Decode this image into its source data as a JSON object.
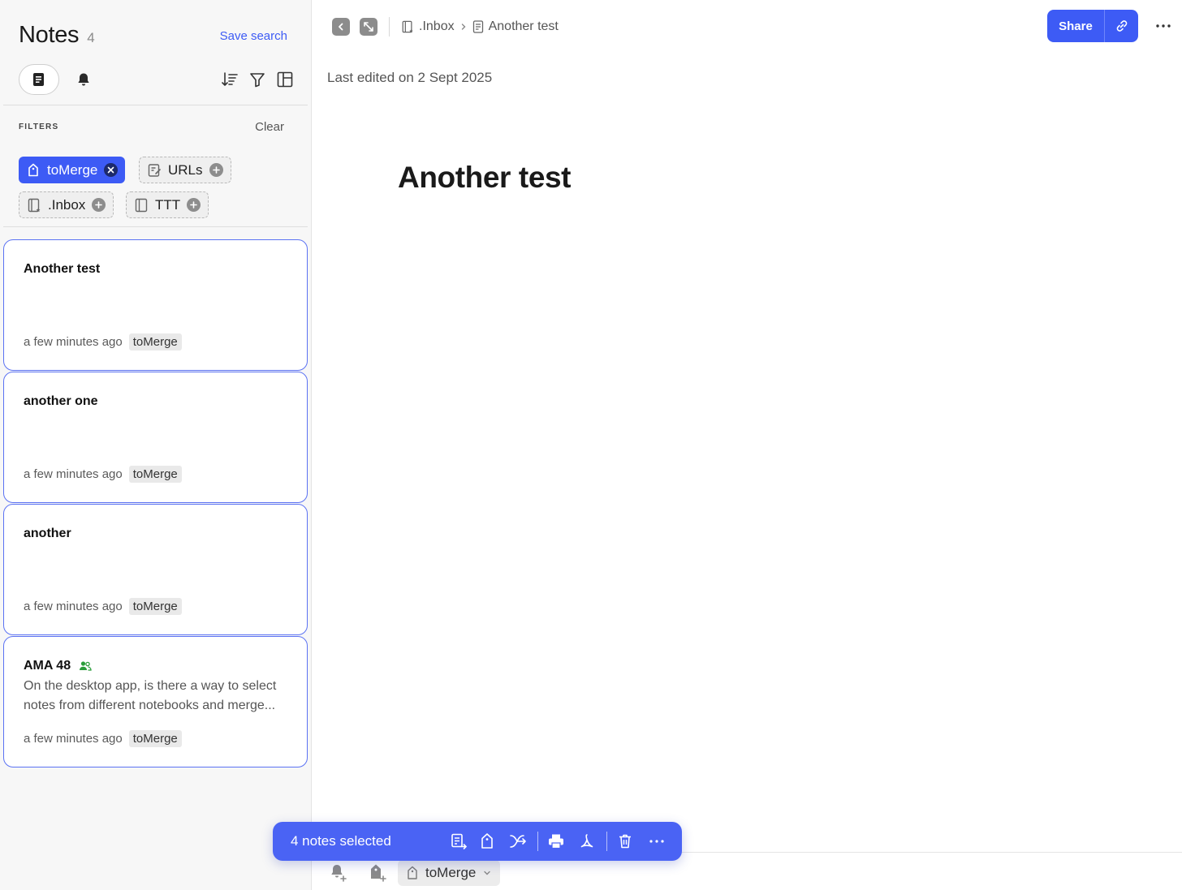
{
  "sidebar": {
    "title": "Notes",
    "count": "4",
    "save_search": "Save search",
    "filters_label": "FILTERS",
    "clear": "Clear",
    "chips": [
      {
        "label": "toMerge",
        "icon": "tag-icon",
        "active": true
      },
      {
        "label": "URLs",
        "icon": "url-note-icon",
        "active": false
      },
      {
        "label": ".Inbox",
        "icon": "inbox-notebook-icon",
        "active": false
      },
      {
        "label": "TTT",
        "icon": "notebook-icon",
        "active": false
      }
    ],
    "notes": [
      {
        "title": "Another test",
        "snippet": "",
        "time": "a few minutes ago",
        "tag": "toMerge",
        "shared": false
      },
      {
        "title": "another one",
        "snippet": "",
        "time": "a few minutes ago",
        "tag": "toMerge",
        "shared": false
      },
      {
        "title": "another",
        "snippet": "",
        "time": "a few minutes ago",
        "tag": "toMerge",
        "shared": false
      },
      {
        "title": "AMA 48",
        "snippet": "On the desktop app, is there a way to select notes from different notebooks and merge...",
        "time": "a few minutes ago",
        "tag": "toMerge",
        "shared": true
      }
    ]
  },
  "main": {
    "breadcrumb": {
      "notebook": ".Inbox",
      "note": "Another test"
    },
    "share": "Share",
    "last_edited": "Last edited on 2 Sept 2025",
    "doc_title": "Another test",
    "bottom_tag": "toMerge"
  },
  "selection": {
    "text": "4 notes selected"
  },
  "colors": {
    "accent": "#3d5bf5",
    "selection_bar": "#4a63f4",
    "shared_icon": "#2a9d3a"
  }
}
